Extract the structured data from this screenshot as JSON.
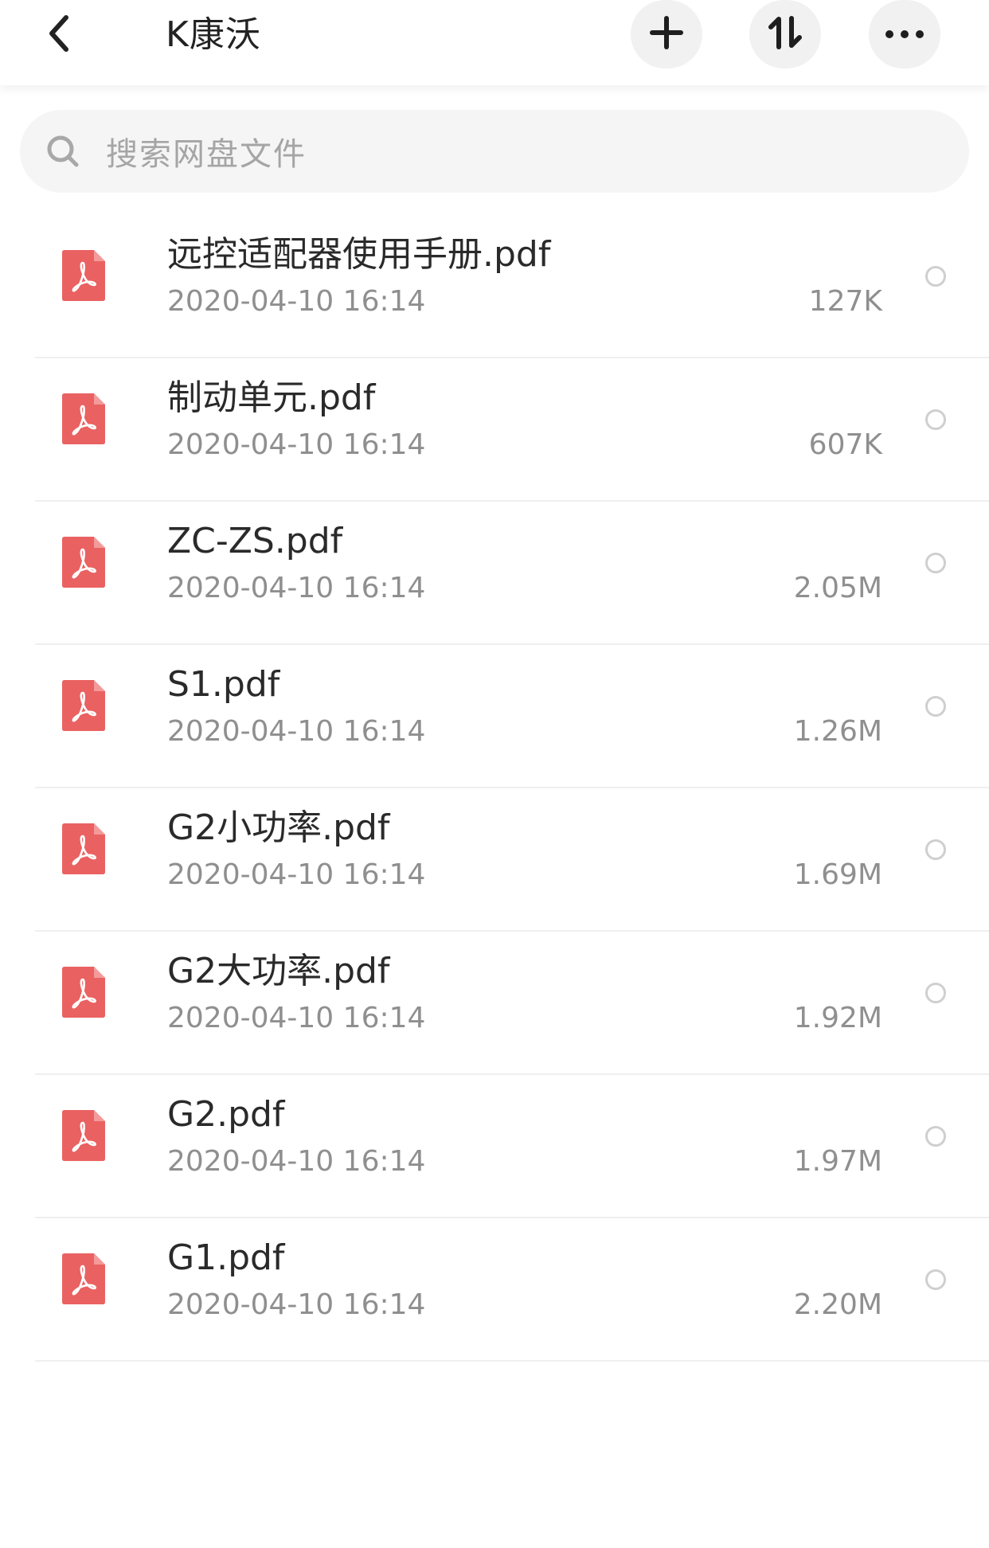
{
  "header": {
    "title": "K康沃",
    "back_icon": "chevron-left-icon",
    "add_icon": "plus-icon",
    "sort_icon": "sort-arrows-icon",
    "more_icon": "more-dots-icon"
  },
  "search": {
    "placeholder": "搜索网盘文件",
    "icon": "search-icon"
  },
  "colors": {
    "pdf_red": "#ea6161",
    "text_primary": "#2a2a2a",
    "text_secondary": "#8f8f8f"
  },
  "files": [
    {
      "name": "远控适配器使用手册.pdf",
      "date": "2020-04-10 16:14",
      "size": "127K",
      "icon": "pdf-file-icon"
    },
    {
      "name": "制动单元.pdf",
      "date": "2020-04-10 16:14",
      "size": "607K",
      "icon": "pdf-file-icon"
    },
    {
      "name": "ZC-ZS.pdf",
      "date": "2020-04-10 16:14",
      "size": "2.05M",
      "icon": "pdf-file-icon"
    },
    {
      "name": "S1.pdf",
      "date": "2020-04-10 16:14",
      "size": "1.26M",
      "icon": "pdf-file-icon"
    },
    {
      "name": "G2小功率.pdf",
      "date": "2020-04-10 16:14",
      "size": "1.69M",
      "icon": "pdf-file-icon"
    },
    {
      "name": "G2大功率.pdf",
      "date": "2020-04-10 16:14",
      "size": "1.92M",
      "icon": "pdf-file-icon"
    },
    {
      "name": "G2.pdf",
      "date": "2020-04-10 16:14",
      "size": "1.97M",
      "icon": "pdf-file-icon"
    },
    {
      "name": "G1.pdf",
      "date": "2020-04-10 16:14",
      "size": "2.20M",
      "icon": "pdf-file-icon"
    }
  ]
}
